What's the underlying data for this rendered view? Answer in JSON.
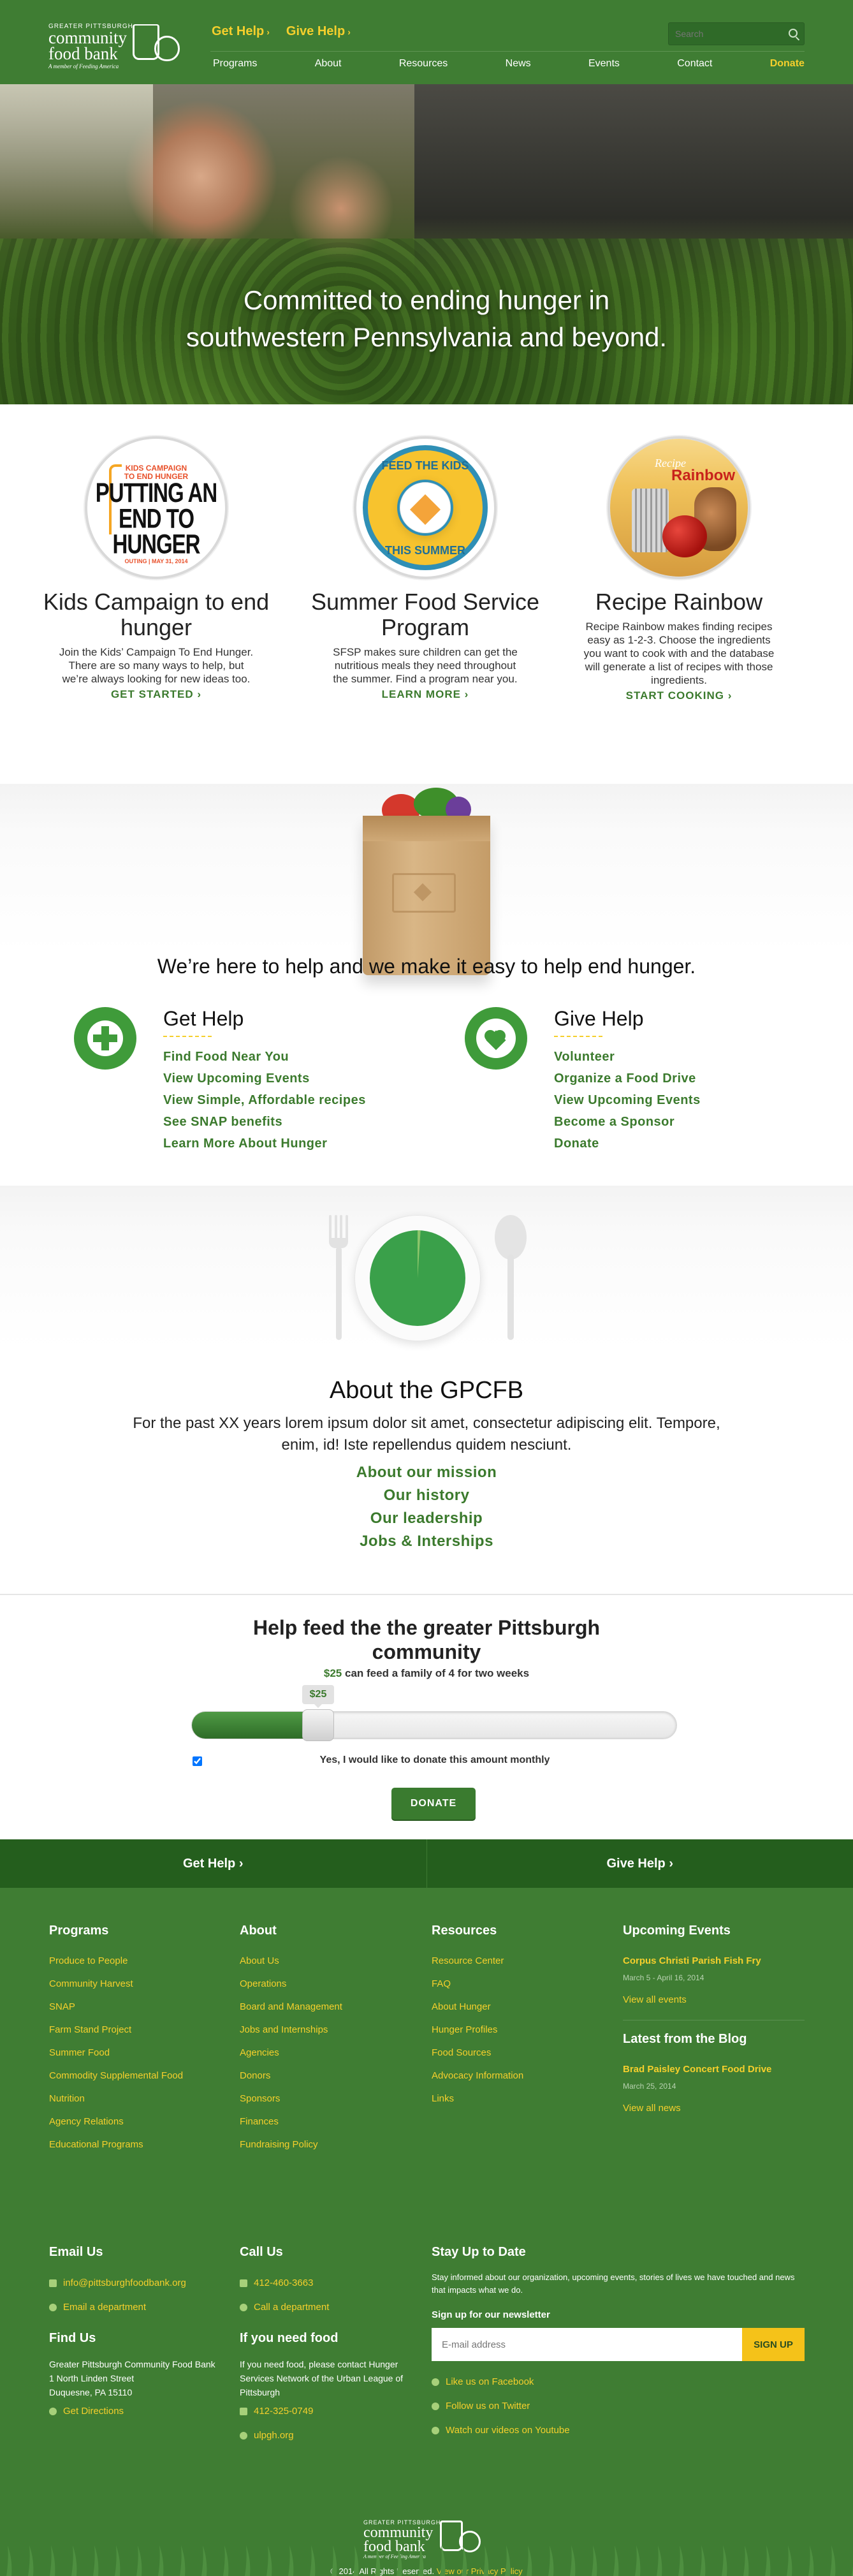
{
  "header": {
    "logo": {
      "small": "GREATER PITTSBURGH",
      "name_line1": "community",
      "name_line2": "food bank",
      "tagline": "A member of Feeding America"
    },
    "top_links": [
      "Get Help",
      "Give Help"
    ],
    "search": {
      "placeholder": "Search"
    },
    "nav": [
      "Programs",
      "About",
      "Resources",
      "News",
      "Events",
      "Contact",
      "Donate"
    ]
  },
  "hero": {
    "headline_line1": "Committed to ending hunger in",
    "headline_line2": "southwestern Pennsylvania and beyond."
  },
  "programs": [
    {
      "title": "Kids Campaign to end hunger",
      "description": "Join the Kids’ Campaign To End Hunger. There are so many ways to help, but we’re always looking for new ideas too.",
      "cta": "GET STARTED",
      "art": {
        "line1": "KIDS CAMPAIGN",
        "line2": "TO END HUNGER",
        "big": "PUTTING AN END TO HUNGER",
        "footer": "OUTING | MAY 31, 2014"
      }
    },
    {
      "title": "Summer Food Service Program",
      "description": "SFSP makes sure children can get the nutritious meals they need throughout the summer. Find a program near you.",
      "cta": "LEARN MORE",
      "art": {
        "top": "FEED THE KIDS",
        "bottom": "THIS SUMMER"
      }
    },
    {
      "title": "Recipe Rainbow",
      "description": "Recipe Rainbow makes finding recipes easy as 1-2-3. Choose the ingredients you want to cook with and the database will generate a list of recipes with those ingredients.",
      "cta": "START COOKING",
      "art": {
        "top": "Recipe",
        "bottom": "Rainbow"
      }
    }
  ],
  "help": {
    "headline": "We’re here to help and we make it easy to help end hunger.",
    "get_help": {
      "title": "Get Help",
      "links": [
        "Find Food Near You",
        "View Upcoming Events",
        "View Simple, Affordable recipes",
        "See SNAP benefits",
        "Learn More About Hunger"
      ]
    },
    "give_help": {
      "title": "Give Help",
      "links": [
        "Volunteer",
        "Organize a Food Drive",
        "View Upcoming Events",
        "Become a Sponsor",
        "Donate"
      ]
    }
  },
  "about": {
    "title": "About the GPCFB",
    "text": "For the past XX years lorem ipsum dolor sit amet, consectetur adipiscing elit. Tempore, enim, id! Iste repellendus quidem nesciunt.",
    "links": [
      "About our mission",
      "Our history",
      "Our leadership",
      "Jobs & Interships"
    ],
    "plate_fraction": 0.99
  },
  "donate": {
    "title": "Help feed the the greater Pittsburgh community",
    "amount": "$25",
    "subtitle_rest": "can feed a family of 4 for two weeks",
    "slider_fraction": 0.26,
    "monthly_label": "Yes, I would like to donate this amount monthly",
    "monthly_checked": true,
    "button": "DONATE"
  },
  "footer": {
    "bar": [
      "Get Help",
      "Give Help"
    ],
    "columns": [
      {
        "title": "Programs",
        "links": [
          "Produce to People",
          "Community Harvest",
          "SNAP",
          "Farm Stand Project",
          "Summer Food",
          "Commodity Supplemental Food",
          "Nutrition",
          "Agency Relations",
          "Educational Programs"
        ]
      },
      {
        "title": "About",
        "links": [
          "About Us",
          "Operations",
          "Board and Management",
          "Jobs and Internships",
          "Agencies",
          "Donors",
          "Sponsors",
          "Finances",
          "Fundraising Policy"
        ]
      },
      {
        "title": "Resources",
        "links": [
          "Resource Center",
          "FAQ",
          "About Hunger",
          "Hunger Profiles",
          "Food Sources",
          "Advocacy Information",
          "Links"
        ]
      }
    ],
    "events": {
      "title": "Upcoming Events",
      "item_title": "Corpus Christi Parish Fish Fry",
      "item_date": "March 5 - April 16, 2014",
      "view_all": "View all events"
    },
    "blog": {
      "title": "Latest from the Blog",
      "item_title": "Brad Paisley Concert Food Drive",
      "item_date": "March 25, 2014",
      "view_all": "View all news"
    },
    "email": {
      "title": "Email Us",
      "address": "info@pittsburghfoodbank.org",
      "dept": "Email a department"
    },
    "call": {
      "title": "Call Us",
      "phone": "412-460-3663",
      "dept": "Call a department"
    },
    "find": {
      "title": "Find Us",
      "line1": "Greater Pittsburgh Community Food Bank",
      "line2": "1 North Linden Street",
      "line3": "Duquesne, PA 15110",
      "directions": "Get Directions"
    },
    "need_food": {
      "title": "If you need food",
      "text": "If you need food, please contact Hunger Services Network of the Urban League of Pittsburgh",
      "phone": "412-325-0749",
      "site": "ulpgh.org"
    },
    "stay": {
      "title": "Stay Up to Date",
      "text": "Stay informed about our organization, upcoming events, stories of lives we have touched and news that impacts what we do.",
      "signup_label": "Sign up for our newsletter",
      "placeholder": "E-mail address",
      "button": "SIGN UP",
      "social": [
        "Like us on Facebook",
        "Follow us on Twitter",
        "Watch our videos on Youtube"
      ]
    },
    "copyright": "© 2014 All Rights Reserved.",
    "privacy": "View our Privacy Policy"
  },
  "colors": {
    "green": "#3f7d33",
    "dark_green": "#245e1d",
    "yellow": "#f5cf2c",
    "link_green": "#3b7a2d"
  }
}
